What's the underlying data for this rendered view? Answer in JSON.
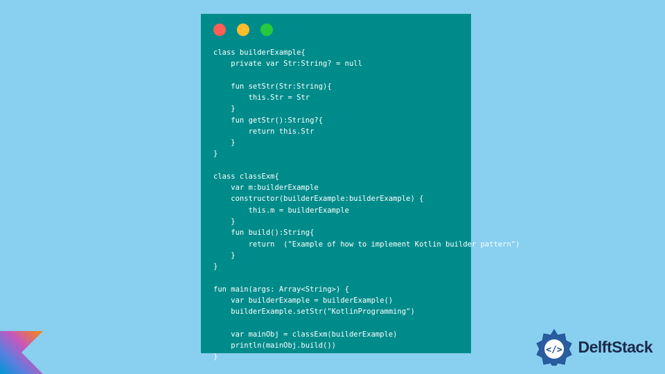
{
  "code": {
    "lines": [
      "class builderExample{",
      "    private var Str:String? = null",
      "",
      "    fun setStr(Str:String){",
      "        this.Str = Str",
      "    }",
      "    fun getStr():String?{",
      "        return this.Str",
      "    }",
      "}",
      "",
      "class classExm{",
      "    var m:builderExample",
      "    constructor(builderExample:builderExample) {",
      "        this.m = builderExample",
      "    }",
      "    fun build():String{",
      "        return  (\"Example of how to implement Kotlin builder pattern\")",
      "    }",
      "}",
      "",
      "fun main(args: Array<String>) {",
      "    var builderExample = builderExample()",
      "    builderExample.setStr(\"KotlinProgramming\")",
      "",
      "    var mainObj = classExm(builderExample)",
      "    println(mainObj.build())",
      "}"
    ]
  },
  "brand": {
    "name": "DelftStack"
  },
  "colors": {
    "background": "#89cff0",
    "window": "#008b8b",
    "text": "#ffffff",
    "brand_text": "#1a2b4a",
    "brand_icon": "#1a4d8f"
  }
}
